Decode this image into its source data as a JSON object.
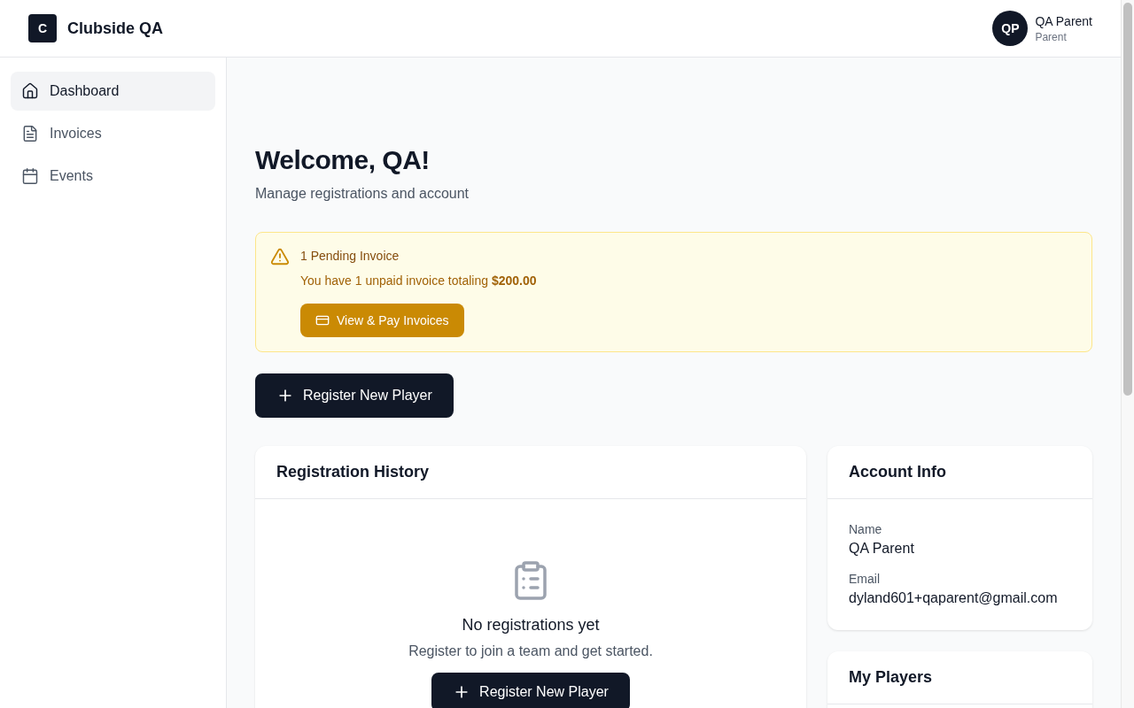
{
  "app": {
    "logo_letter": "C",
    "name": "Clubside QA"
  },
  "user": {
    "initials": "QP",
    "name": "QA Parent",
    "role": "Parent"
  },
  "sidebar": {
    "items": [
      {
        "label": "Dashboard",
        "selected": true
      },
      {
        "label": "Invoices",
        "selected": false
      },
      {
        "label": "Events",
        "selected": false
      }
    ]
  },
  "page": {
    "title": "Welcome, QA!",
    "subtitle": "Manage registrations and account"
  },
  "alert": {
    "title": "1 Pending Invoice",
    "message": "You have 1 unpaid invoice totaling **$200.00**",
    "button": "View & Pay Invoices"
  },
  "register_button": "Register New Player",
  "registration_history": {
    "title": "Registration History",
    "empty_title": "No registrations yet",
    "empty_message": "Register to join a team and get started.",
    "button": "Register New Player"
  },
  "account_info": {
    "title": "Account Info",
    "fields": [
      {
        "label": "Name",
        "value": "QA Parent"
      },
      {
        "label": "Email",
        "value": "dyland601+qaparent@gmail.com"
      }
    ]
  },
  "my_players": {
    "title": "My Players"
  }
}
